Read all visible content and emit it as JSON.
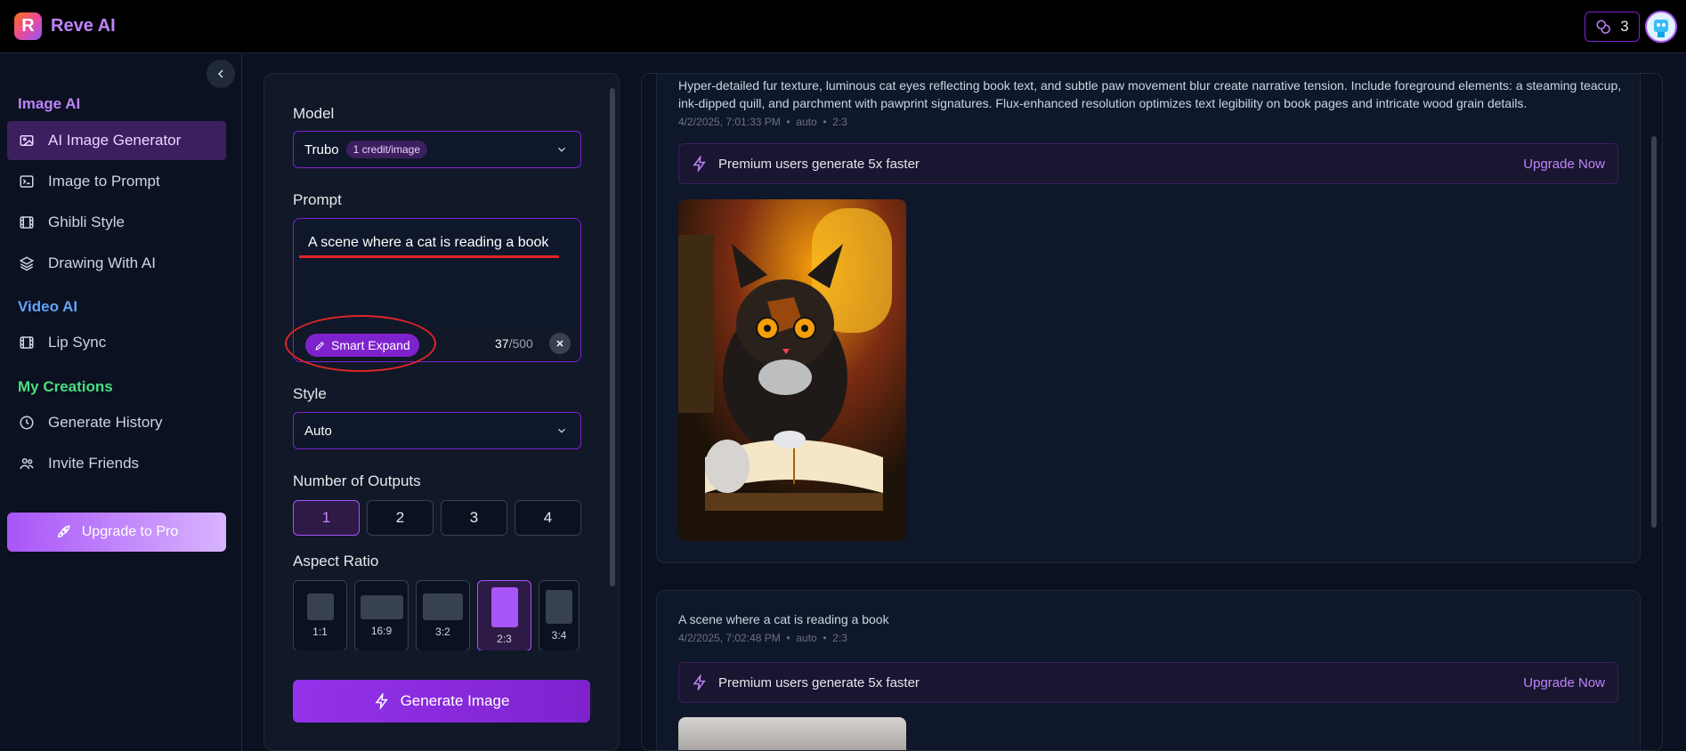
{
  "app": {
    "name": "Reve AI",
    "logo_letter": "R"
  },
  "topbar": {
    "credits": "3"
  },
  "sidebar": {
    "sections": [
      {
        "title": "Image AI",
        "color": "#c084fc",
        "items": [
          {
            "label": "AI Image Generator",
            "icon": "image-icon",
            "active": true
          },
          {
            "label": "Image to Prompt",
            "icon": "terminal-icon"
          },
          {
            "label": "Ghibli Style",
            "icon": "film-icon"
          },
          {
            "label": "Drawing With AI",
            "icon": "layers-icon"
          }
        ]
      },
      {
        "title": "Video AI",
        "color": "#60a5fa",
        "items": [
          {
            "label": "Lip Sync",
            "icon": "film-icon"
          }
        ]
      },
      {
        "title": "My Creations",
        "color": "#4ade80",
        "items": [
          {
            "label": "Generate History",
            "icon": "clock-icon"
          },
          {
            "label": "Invite Friends",
            "icon": "users-icon"
          }
        ]
      }
    ],
    "upgrade_label": "Upgrade to Pro"
  },
  "form": {
    "model_label": "Model",
    "model_value": "Trubo",
    "model_badge": "1 credit/image",
    "prompt_label": "Prompt",
    "prompt_value": "A scene where a cat is reading a book",
    "smart_expand": "Smart Expand",
    "char_count": "37",
    "char_max": "/500",
    "style_label": "Style",
    "style_value": "Auto",
    "outputs_label": "Number of Outputs",
    "outputs": [
      "1",
      "2",
      "3",
      "4"
    ],
    "outputs_selected": "1",
    "aspect_label": "Aspect Ratio",
    "aspects": [
      "1:1",
      "16:9",
      "3:2",
      "2:3",
      "3:4"
    ],
    "aspect_selected": "2:3",
    "generate_label": "Generate Image"
  },
  "results": [
    {
      "prompt": "Hyper-detailed fur texture, luminous cat eyes reflecting book text, and subtle paw movement blur create narrative tension. Include foreground elements: a steaming teacup, ink-dipped quill, and parchment with pawprint signatures. Flux-enhanced resolution optimizes text legibility on book pages and intricate wood grain details.",
      "timestamp": "4/2/2025, 7:01:33 PM",
      "style": "auto",
      "ratio": "2:3",
      "premium_text": "Premium users generate 5x faster",
      "upgrade_text": "Upgrade Now"
    },
    {
      "prompt": "A scene where a cat is reading a book",
      "timestamp": "4/2/2025, 7:02:48 PM",
      "style": "auto",
      "ratio": "2:3",
      "premium_text": "Premium users generate 5x faster",
      "upgrade_text": "Upgrade Now"
    }
  ],
  "meta_separator": "•"
}
